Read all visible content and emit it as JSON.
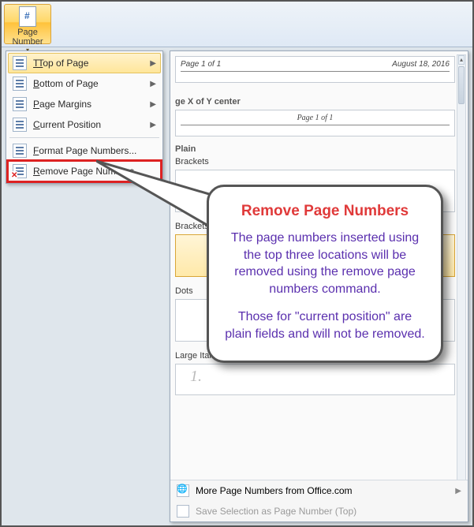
{
  "ribbon": {
    "page_number_label": "Page Number"
  },
  "menu": {
    "top_of_page": "Top of Page",
    "bottom_of_page": "Bottom of Page",
    "page_margins": "Page Margins",
    "current_position": "Current Position",
    "format": "Format Page Numbers...",
    "remove": "Remove Page Numbers",
    "accel": {
      "top": "T",
      "bottom": "B",
      "margins": "P",
      "current": "C",
      "format": "F",
      "remove": "R"
    }
  },
  "gallery": {
    "xofy_label": "ge X of Y center",
    "preview1_left": "Page 1 of 1",
    "preview1_right": "August 18, 2016",
    "preview2_center": "Page 1 of 1",
    "section_plain": "Plain",
    "brackets1": "Brackets",
    "brackets2": "Brackets 2",
    "dots": "Dots",
    "large_italics": "Large Italics 1",
    "large_italics_sample": "1.",
    "more": "More Page Numbers from Office.com",
    "save_sel": "Save Selection as Page Number (Top)",
    "more_accel": "M",
    "save_accel": "S"
  },
  "callout": {
    "title": "Remove Page Numbers",
    "p1": "The page numbers inserted using the top three locations will be removed using the remove page numbers command.",
    "p2": "Those for \"current position\" are plain fields and will not be removed."
  }
}
